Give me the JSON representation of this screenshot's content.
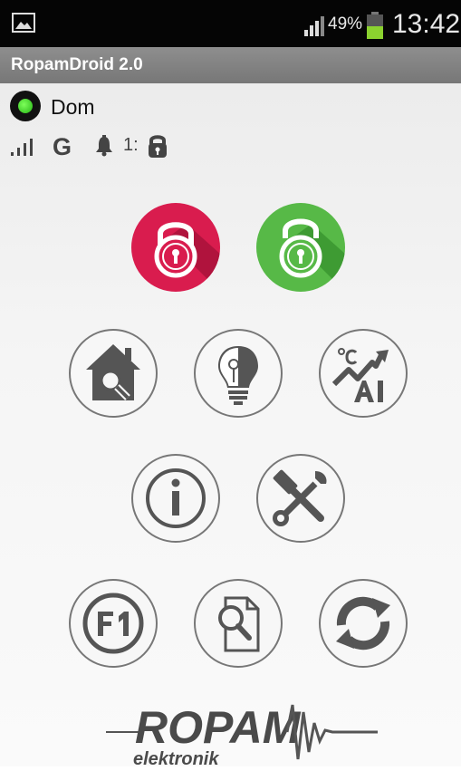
{
  "status_bar": {
    "battery_percent": "49%",
    "time": "13:42",
    "battery_level": 0.49
  },
  "app": {
    "title": "RopamDroid 2.0"
  },
  "device": {
    "name": "Dom",
    "connection_status_color": "#2db51a",
    "network_type": "G",
    "zone_label": "1:"
  },
  "buttons": {
    "arm_icon": "lock-closed-icon",
    "disarm_icon": "lock-open-icon",
    "arm_color": "#d91c4e",
    "disarm_color": "#57b947"
  },
  "logo": {
    "brand": "ROPAM",
    "sub": "elektronik"
  }
}
